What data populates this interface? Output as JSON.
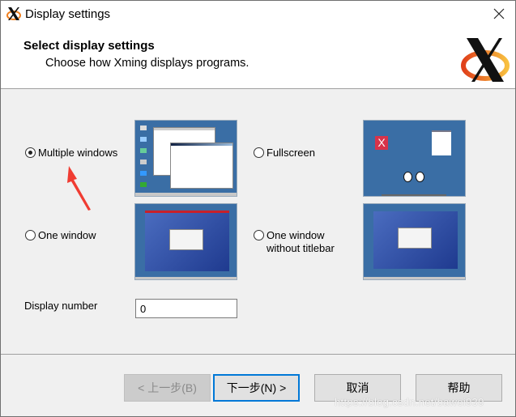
{
  "window": {
    "title": "Display settings",
    "close_icon": "close-icon",
    "app_icon": "xming-x-icon"
  },
  "header": {
    "title": "Select display settings",
    "subtitle": "Choose how Xming displays programs.",
    "logo": "xming-logo"
  },
  "options": [
    {
      "label": "Multiple windows",
      "checked": true,
      "preview": "multiple-windows-preview"
    },
    {
      "label": "Fullscreen",
      "checked": false,
      "preview": "fullscreen-preview"
    },
    {
      "label": "One window",
      "checked": false,
      "preview": "one-window-preview"
    },
    {
      "label_line1": "One window",
      "label_line2": "without titlebar",
      "checked": false,
      "preview": "one-window-no-titlebar-preview"
    }
  ],
  "display_number": {
    "label": "Display number",
    "value": "0"
  },
  "buttons": {
    "back": "< 上一步(B)",
    "next": "下一步(N) >",
    "cancel": "取消",
    "help": "帮助"
  },
  "annotation": {
    "arrow_color": "#f03c32"
  },
  "watermark": "https://blog.csdn.net/bawei939",
  "colors": {
    "accent": "#0078d7",
    "preview_blue": "#3a6ea5"
  }
}
